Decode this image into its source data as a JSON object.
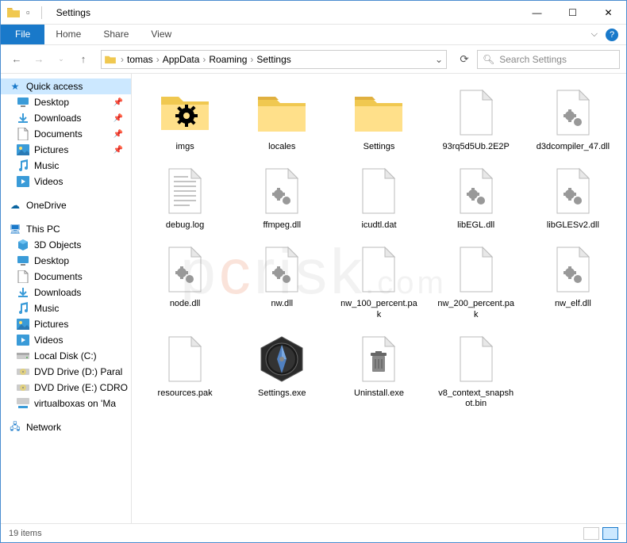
{
  "window": {
    "title": "Settings"
  },
  "ribbon": {
    "file": "File",
    "home": "Home",
    "share": "Share",
    "view": "View"
  },
  "breadcrumbs": [
    "tomas",
    "AppData",
    "Roaming",
    "Settings"
  ],
  "search": {
    "placeholder": "Search Settings"
  },
  "sidebar": {
    "quick_access": "Quick access",
    "quick_items": [
      {
        "label": "Desktop",
        "pinned": true,
        "icon": "desktop"
      },
      {
        "label": "Downloads",
        "pinned": true,
        "icon": "downloads"
      },
      {
        "label": "Documents",
        "pinned": true,
        "icon": "documents"
      },
      {
        "label": "Pictures",
        "pinned": true,
        "icon": "pictures"
      },
      {
        "label": "Music",
        "pinned": false,
        "icon": "music"
      },
      {
        "label": "Videos",
        "pinned": false,
        "icon": "videos"
      }
    ],
    "onedrive": "OneDrive",
    "this_pc": "This PC",
    "pc_items": [
      {
        "label": "3D Objects",
        "icon": "3d"
      },
      {
        "label": "Desktop",
        "icon": "desktop"
      },
      {
        "label": "Documents",
        "icon": "documents"
      },
      {
        "label": "Downloads",
        "icon": "downloads"
      },
      {
        "label": "Music",
        "icon": "music"
      },
      {
        "label": "Pictures",
        "icon": "pictures"
      },
      {
        "label": "Videos",
        "icon": "videos"
      },
      {
        "label": "Local Disk (C:)",
        "icon": "disk"
      },
      {
        "label": "DVD Drive (D:) Paral",
        "icon": "dvd"
      },
      {
        "label": "DVD Drive (E:) CDRO",
        "icon": "dvd"
      },
      {
        "label": "virtualboxas on 'Ma",
        "icon": "netdisk"
      }
    ],
    "network": "Network"
  },
  "files": [
    {
      "label": "imgs",
      "type": "folder-gear"
    },
    {
      "label": "locales",
      "type": "folder"
    },
    {
      "label": "Settings",
      "type": "folder"
    },
    {
      "label": "93rq5d5Ub.2E2P",
      "type": "file"
    },
    {
      "label": "d3dcompiler_47.dll",
      "type": "dll"
    },
    {
      "label": "debug.log",
      "type": "text"
    },
    {
      "label": "ffmpeg.dll",
      "type": "dll"
    },
    {
      "label": "icudtl.dat",
      "type": "file"
    },
    {
      "label": "libEGL.dll",
      "type": "dll"
    },
    {
      "label": "libGLESv2.dll",
      "type": "dll"
    },
    {
      "label": "node.dll",
      "type": "dll"
    },
    {
      "label": "nw.dll",
      "type": "dll"
    },
    {
      "label": "nw_100_percent.pak",
      "type": "file"
    },
    {
      "label": "nw_200_percent.pak",
      "type": "file"
    },
    {
      "label": "nw_elf.dll",
      "type": "dll"
    },
    {
      "label": "resources.pak",
      "type": "file"
    },
    {
      "label": "Settings.exe",
      "type": "compass"
    },
    {
      "label": "Uninstall.exe",
      "type": "uninstall"
    },
    {
      "label": "v8_context_snapshot.bin",
      "type": "file"
    }
  ],
  "status": {
    "count": "19 items"
  },
  "colors": {
    "accent": "#1979ca",
    "folder": "#f0c850",
    "border": "#4a8dd0"
  }
}
